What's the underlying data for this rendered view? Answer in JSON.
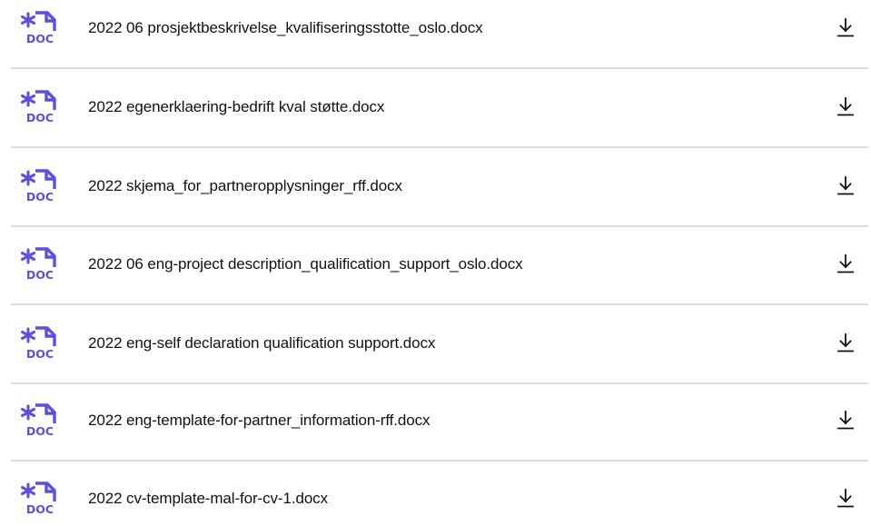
{
  "accent_color": "#5b4fe8",
  "files": [
    {
      "name": "2022 06 prosjektbeskrivelse_kvalifiseringsstotte_oslo.docx",
      "icon": "doc-file-icon",
      "icon_label": "DOC",
      "action_icon": "download-icon"
    },
    {
      "name": "2022 egenerklaering-bedrift kval støtte.docx",
      "icon": "doc-file-icon",
      "icon_label": "DOC",
      "action_icon": "download-icon"
    },
    {
      "name": "2022 skjema_for_partneropplysninger_rff.docx",
      "icon": "doc-file-icon",
      "icon_label": "DOC",
      "action_icon": "download-icon"
    },
    {
      "name": "2022 06 eng-project description_qualification_support_oslo.docx",
      "icon": "doc-file-icon",
      "icon_label": "DOC",
      "action_icon": "download-icon"
    },
    {
      "name": "2022 eng-self declaration qualification support.docx",
      "icon": "doc-file-icon",
      "icon_label": "DOC",
      "action_icon": "download-icon"
    },
    {
      "name": "2022 eng-template-for-partner_information-rff.docx",
      "icon": "doc-file-icon",
      "icon_label": "DOC",
      "action_icon": "download-icon"
    },
    {
      "name": "2022 cv-template-mal-for-cv-1.docx",
      "icon": "doc-file-icon",
      "icon_label": "DOC",
      "action_icon": "download-icon"
    }
  ]
}
